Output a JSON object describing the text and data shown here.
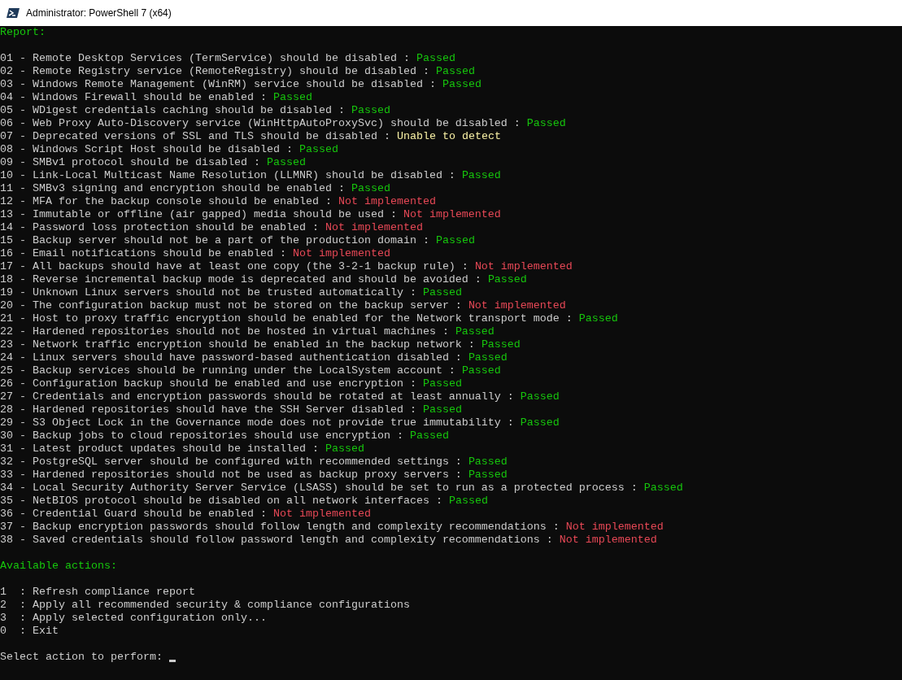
{
  "window": {
    "title": "Administrator: PowerShell 7 (x64)"
  },
  "report": {
    "heading": "Report:",
    "checks": [
      {
        "label": "01 - Remote Desktop Services (TermService) should be disabled :",
        "status": "Passed",
        "kind": "passed"
      },
      {
        "label": "02 - Remote Registry service (RemoteRegistry) should be disabled :",
        "status": "Passed",
        "kind": "passed"
      },
      {
        "label": "03 - Windows Remote Management (WinRM) service should be disabled :",
        "status": "Passed",
        "kind": "passed"
      },
      {
        "label": "04 - Windows Firewall should be enabled :",
        "status": "Passed",
        "kind": "passed"
      },
      {
        "label": "05 - WDigest credentials caching should be disabled :",
        "status": "Passed",
        "kind": "passed"
      },
      {
        "label": "06 - Web Proxy Auto-Discovery service (WinHttpAutoProxySvc) should be disabled :",
        "status": "Passed",
        "kind": "passed"
      },
      {
        "label": "07 - Deprecated versions of SSL and TLS should be disabled :",
        "status": "Unable to detect",
        "kind": "warning"
      },
      {
        "label": "08 - Windows Script Host should be disabled :",
        "status": "Passed",
        "kind": "passed"
      },
      {
        "label": "09 - SMBv1 protocol should be disabled :",
        "status": "Passed",
        "kind": "passed"
      },
      {
        "label": "10 - Link-Local Multicast Name Resolution (LLMNR) should be disabled :",
        "status": "Passed",
        "kind": "passed"
      },
      {
        "label": "11 - SMBv3 signing and encryption should be enabled :",
        "status": "Passed",
        "kind": "passed"
      },
      {
        "label": "12 - MFA for the backup console should be enabled :",
        "status": "Not implemented",
        "kind": "failed"
      },
      {
        "label": "13 - Immutable or offline (air gapped) media should be used :",
        "status": "Not implemented",
        "kind": "failed"
      },
      {
        "label": "14 - Password loss protection should be enabled :",
        "status": "Not implemented",
        "kind": "failed"
      },
      {
        "label": "15 - Backup server should not be a part of the production domain :",
        "status": "Passed",
        "kind": "passed"
      },
      {
        "label": "16 - Email notifications should be enabled :",
        "status": "Not implemented",
        "kind": "failed"
      },
      {
        "label": "17 - All backups should have at least one copy (the 3-2-1 backup rule) :",
        "status": "Not implemented",
        "kind": "failed"
      },
      {
        "label": "18 - Reverse incremental backup mode is deprecated and should be avoided :",
        "status": "Passed",
        "kind": "passed"
      },
      {
        "label": "19 - Unknown Linux servers should not be trusted automatically :",
        "status": "Passed",
        "kind": "passed"
      },
      {
        "label": "20 - The configuration backup must not be stored on the backup server :",
        "status": "Not implemented",
        "kind": "failed"
      },
      {
        "label": "21 - Host to proxy traffic encryption should be enabled for the Network transport mode :",
        "status": "Passed",
        "kind": "passed"
      },
      {
        "label": "22 - Hardened repositories should not be hosted in virtual machines :",
        "status": "Passed",
        "kind": "passed"
      },
      {
        "label": "23 - Network traffic encryption should be enabled in the backup network :",
        "status": "Passed",
        "kind": "passed"
      },
      {
        "label": "24 - Linux servers should have password-based authentication disabled :",
        "status": "Passed",
        "kind": "passed"
      },
      {
        "label": "25 - Backup services should be running under the LocalSystem account :",
        "status": "Passed",
        "kind": "passed"
      },
      {
        "label": "26 - Configuration backup should be enabled and use encryption :",
        "status": "Passed",
        "kind": "passed"
      },
      {
        "label": "27 - Credentials and encryption passwords should be rotated at least annually :",
        "status": "Passed",
        "kind": "passed"
      },
      {
        "label": "28 - Hardened repositories should have the SSH Server disabled :",
        "status": "Passed",
        "kind": "passed"
      },
      {
        "label": "29 - S3 Object Lock in the Governance mode does not provide true immutability :",
        "status": "Passed",
        "kind": "passed"
      },
      {
        "label": "30 - Backup jobs to cloud repositories should use encryption :",
        "status": "Passed",
        "kind": "passed"
      },
      {
        "label": "31 - Latest product updates should be installed :",
        "status": "Passed",
        "kind": "passed"
      },
      {
        "label": "32 - PostgreSQL server should be configured with recommended settings :",
        "status": "Passed",
        "kind": "passed"
      },
      {
        "label": "33 - Hardened repositories should not be used as backup proxy servers :",
        "status": "Passed",
        "kind": "passed"
      },
      {
        "label": "34 - Local Security Authority Server Service (LSASS) should be set to run as a protected process :",
        "status": "Passed",
        "kind": "passed"
      },
      {
        "label": "35 - NetBIOS protocol should be disabled on all network interfaces :",
        "status": "Passed",
        "kind": "passed"
      },
      {
        "label": "36 - Credential Guard should be enabled :",
        "status": "Not implemented",
        "kind": "failed"
      },
      {
        "label": "37 - Backup encryption passwords should follow length and complexity recommendations :",
        "status": "Not implemented",
        "kind": "failed"
      },
      {
        "label": "38 - Saved credentials should follow password length and complexity recommendations :",
        "status": "Not implemented",
        "kind": "failed"
      }
    ]
  },
  "actions": {
    "heading": "Available actions:",
    "items": [
      "1  : Refresh compliance report",
      "2  : Apply all recommended security & compliance configurations",
      "3  : Apply selected configuration only...",
      "0  : Exit"
    ]
  },
  "prompt": "Select action to perform:"
}
